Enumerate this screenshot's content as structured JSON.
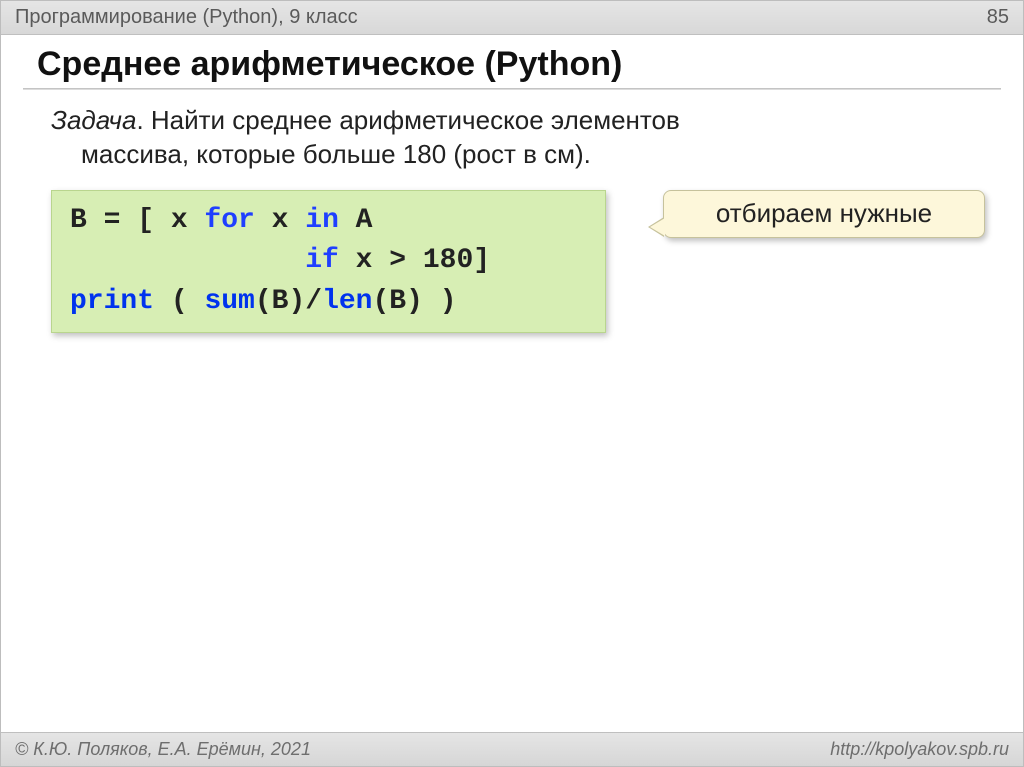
{
  "topbar": {
    "subject": "Программирование (Python), 9 класс",
    "page": "85"
  },
  "title": "Среднее арифметическое (Python)",
  "task": {
    "label": "Задача",
    "line1": ". Найти среднее арифметическое элементов",
    "line2": "массива, которые больше 180 (рост в см)."
  },
  "code": {
    "l1_a": "B = [ x ",
    "l1_for": "for",
    "l1_b": " x ",
    "l1_in": "in",
    "l1_c": " A",
    "l2_a": "              ",
    "l2_if": "if",
    "l2_b": " x > 180]",
    "l3_print": "print",
    "l3_a": " ( ",
    "l3_sum": "sum",
    "l3_b": "(B)/",
    "l3_len": "len",
    "l3_c": "(B) )"
  },
  "callout": "отбираем нужные",
  "footer": {
    "left": "© К.Ю. Поляков, Е.А. Ерёмин, 2021",
    "right": "http://kpolyakov.spb.ru"
  }
}
